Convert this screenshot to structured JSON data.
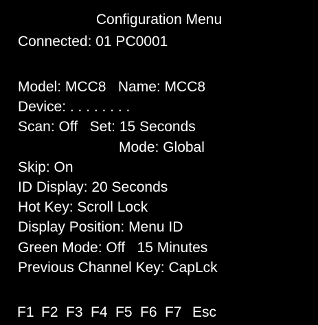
{
  "menu": {
    "title": "Configuration Menu",
    "connected": "Connected: 01 PC0001",
    "model_name": "Model: MCC8   Name: MCC8",
    "device": "Device: . . . . . . . .",
    "scan_set": "Scan: Off   Set: 15 Seconds",
    "mode": "Mode: Global",
    "skip": "Skip: On",
    "id_display": "ID Display: 20 Seconds",
    "hot_key": "Hot Key: Scroll Lock",
    "display_position": "Display Position: Menu ID",
    "green_mode": "Green Mode: Off   15 Minutes",
    "previous_channel_key": "Previous Channel Key: CapLck"
  },
  "function_keys": [
    {
      "label": "F1"
    },
    {
      "label": "F2"
    },
    {
      "label": "F3"
    },
    {
      "label": "F4"
    },
    {
      "label": "F5"
    },
    {
      "label": "F6"
    },
    {
      "label": "F7"
    },
    {
      "label": "Esc"
    }
  ],
  "colors": {
    "background": "#000000",
    "text": "#ffffff"
  }
}
